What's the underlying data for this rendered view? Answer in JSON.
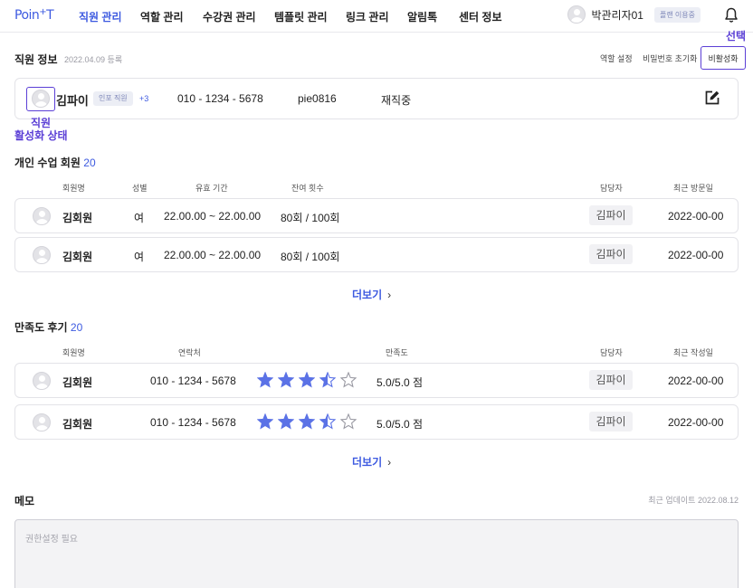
{
  "nav": {
    "logo": "Poin",
    "logo_suffix": "T",
    "items": [
      {
        "label": "직원 관리",
        "active": true
      },
      {
        "label": "역할 관리"
      },
      {
        "label": "수강권 관리"
      },
      {
        "label": "템플릿 관리"
      },
      {
        "label": "링크 관리"
      },
      {
        "label": "알림톡"
      },
      {
        "label": "센터 정보"
      }
    ],
    "admin_name": "박관리자01",
    "plan_badge": "플랜 이용중",
    "icons": {
      "bell": "bell-icon",
      "avatar": "avatar-icon"
    }
  },
  "annotations": {
    "select": "선택",
    "staff": "직원",
    "active_state": "활성화 상태",
    "color": "#5b3fd6"
  },
  "staff_info": {
    "title": "직원 정보",
    "registered": "2022.04.09 등록",
    "actions": {
      "set_role": "역할 설정",
      "reset_password": "비밀번호 초기화",
      "deactivate": "비활성화"
    },
    "name": "김파이",
    "role": "인포 직원",
    "role_more": "+3",
    "phone": "010 - 1234 - 5678",
    "user_id": "pie0816",
    "status": "재직중"
  },
  "private_members": {
    "title": "개인 수업 회원",
    "count": "20",
    "headers": {
      "name": "회원명",
      "gender": "성별",
      "period": "유효 기간",
      "remaining": "잔여 횟수",
      "manager": "담당자",
      "last_visit": "최근 방문일"
    },
    "rows": [
      {
        "name": "김회원",
        "gender": "여",
        "period": "22.00.00 ~ 22.00.00",
        "remaining": "80회 / 100회",
        "manager": "김파이",
        "last_visit": "2022-00-00"
      },
      {
        "name": "김회원",
        "gender": "여",
        "period": "22.00.00 ~ 22.00.00",
        "remaining": "80회 / 100회",
        "manager": "김파이",
        "last_visit": "2022-00-00"
      }
    ],
    "more": "더보기"
  },
  "reviews": {
    "title": "만족도 후기",
    "count": "20",
    "headers": {
      "name": "회원명",
      "contact": "연락처",
      "satisfaction": "만족도",
      "manager": "담당자",
      "last_written": "최근 작성일"
    },
    "rows": [
      {
        "name": "김회원",
        "contact": "010 - 1234 - 5678",
        "stars": 3.5,
        "max_stars": 5,
        "score": "5.0/5.0 점",
        "manager": "김파이",
        "date": "2022-00-00"
      },
      {
        "name": "김회원",
        "contact": "010 - 1234 - 5678",
        "stars": 3.5,
        "max_stars": 5,
        "score": "5.0/5.0 점",
        "manager": "김파이",
        "date": "2022-00-00"
      }
    ],
    "more": "더보기",
    "star_color": "#5b72e6"
  },
  "memo": {
    "title": "메모",
    "updated": "최근 업데이트 2022.08.12",
    "placeholder": "권한설정 필요"
  }
}
